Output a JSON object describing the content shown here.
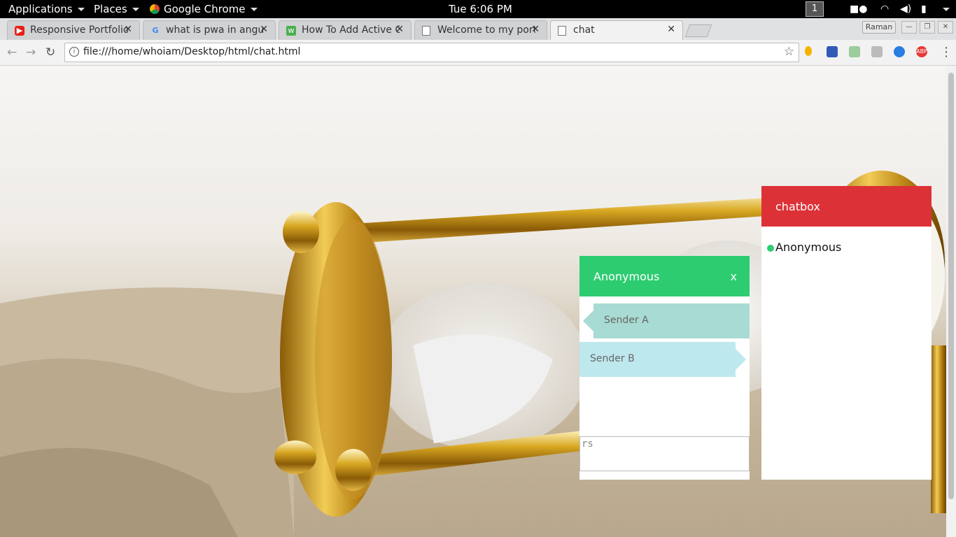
{
  "desktop": {
    "applications": "Applications",
    "places": "Places",
    "active_app": "Google Chrome",
    "clock": "Tue  6:06 PM",
    "workspace": "1"
  },
  "browser": {
    "tabs": [
      {
        "title": "Responsive Portfolio",
        "icon": "youtube-icon",
        "active": false
      },
      {
        "title": "what is pwa in angular",
        "icon": "google-icon",
        "active": false
      },
      {
        "title": "How To Add Active C",
        "icon": "w3schools-icon",
        "active": false
      },
      {
        "title": "Welcome to my port",
        "icon": "page-icon",
        "active": false
      },
      {
        "title": "chat",
        "icon": "page-icon",
        "active": true
      }
    ],
    "profile": "Raman",
    "url": "file:///home/whoiam/Desktop/html/chat.html"
  },
  "page": {
    "chatbox_title": "chatbox",
    "online_users": [
      "Anonymous"
    ],
    "conversation": {
      "title": "Anonymous",
      "close": "x",
      "messages": [
        {
          "sender": "Sender A",
          "side": "left"
        },
        {
          "sender": "Sender B",
          "side": "right"
        }
      ],
      "input_value": "rs"
    }
  }
}
